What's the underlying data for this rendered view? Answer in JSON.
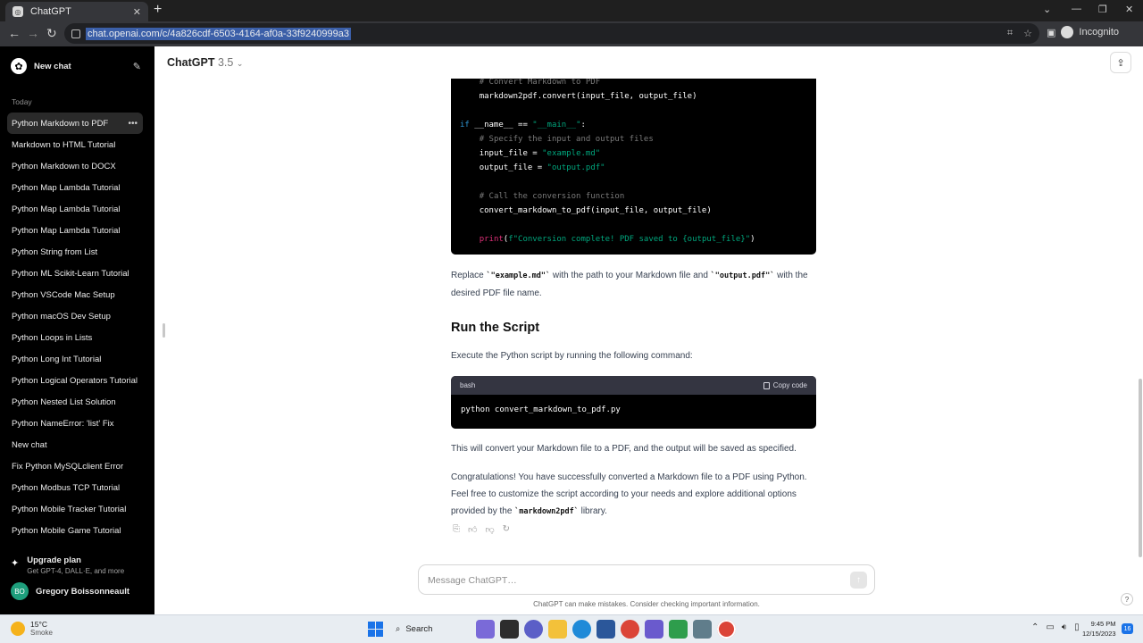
{
  "browser": {
    "tab_title": "ChatGPT",
    "tab_close": "✕",
    "new_tab": "+",
    "url": "chat.openai.com/c/4a826cdf-6503-4164-af0a-33f9240999a3",
    "profile_label": "Incognito"
  },
  "sidebar": {
    "new_chat_label": "New chat",
    "section_label": "Today",
    "items": [
      {
        "label": "Python Markdown to PDF"
      },
      {
        "label": "Markdown to HTML Tutorial"
      },
      {
        "label": "Python Markdown to DOCX"
      },
      {
        "label": "Python Map Lambda Tutorial"
      },
      {
        "label": "Python Map Lambda Tutorial"
      },
      {
        "label": "Python Map Lambda Tutorial"
      },
      {
        "label": "Python String from List"
      },
      {
        "label": "Python ML Scikit-Learn Tutorial"
      },
      {
        "label": "Python VSCode Mac Setup"
      },
      {
        "label": "Python macOS Dev Setup"
      },
      {
        "label": "Python Loops in Lists"
      },
      {
        "label": "Python Long Int Tutorial"
      },
      {
        "label": "Python Logical Operators Tutorial"
      },
      {
        "label": "Python Nested List Solution"
      },
      {
        "label": "Python NameError: 'list' Fix"
      },
      {
        "label": "New chat"
      },
      {
        "label": "Fix Python MySQLclient Error"
      },
      {
        "label": "Python Modbus TCP Tutorial"
      },
      {
        "label": "Python Mobile Tracker Tutorial"
      },
      {
        "label": "Python Mobile Game Tutorial"
      }
    ],
    "upgrade_title": "Upgrade plan",
    "upgrade_sub": "Get GPT-4, DALL·E, and more",
    "user_initials": "BO",
    "user_name": "Gregory Boissonneault"
  },
  "header": {
    "model_name": "ChatGPT",
    "model_version": "3.5"
  },
  "code_block_1": {
    "lines": [
      {
        "indent": "    ",
        "parts": [
          {
            "t": "cm",
            "v": "# Convert Markdown to PDF"
          }
        ]
      },
      {
        "indent": "    ",
        "parts": [
          {
            "t": "tx",
            "v": "markdown2pdf.convert(input_file, output_file)"
          }
        ]
      },
      {
        "indent": "",
        "parts": []
      },
      {
        "indent": "",
        "parts": [
          {
            "t": "kw",
            "v": "if"
          },
          {
            "t": "tx",
            "v": " __name__ == "
          },
          {
            "t": "st",
            "v": "\"__main__\""
          },
          {
            "t": "tx",
            "v": ":"
          }
        ]
      },
      {
        "indent": "    ",
        "parts": [
          {
            "t": "cm",
            "v": "# Specify the input and output files"
          }
        ]
      },
      {
        "indent": "    ",
        "parts": [
          {
            "t": "tx",
            "v": "input_file = "
          },
          {
            "t": "st",
            "v": "\"example.md\""
          }
        ]
      },
      {
        "indent": "    ",
        "parts": [
          {
            "t": "tx",
            "v": "output_file = "
          },
          {
            "t": "st",
            "v": "\"output.pdf\""
          }
        ]
      },
      {
        "indent": "",
        "parts": []
      },
      {
        "indent": "    ",
        "parts": [
          {
            "t": "cm",
            "v": "# Call the conversion function"
          }
        ]
      },
      {
        "indent": "    ",
        "parts": [
          {
            "t": "tx",
            "v": "convert_markdown_to_pdf(input_file, output_file)"
          }
        ]
      },
      {
        "indent": "",
        "parts": []
      },
      {
        "indent": "    ",
        "parts": [
          {
            "t": "fn",
            "v": "print"
          },
          {
            "t": "tx",
            "v": "("
          },
          {
            "t": "st",
            "v": "f\"Conversion complete! PDF saved to {output_file}\""
          },
          {
            "t": "tx",
            "v": ")"
          }
        ]
      }
    ]
  },
  "content": {
    "replace_a": "Replace ",
    "replace_code1": "`\"example.md\"`",
    "replace_b": " with the path to your Markdown file and ",
    "replace_code2": "`\"output.pdf\"`",
    "replace_c": " with the desired PDF file name.",
    "heading": "Run the Script",
    "execute_text": "Execute the Python script by running the following command:",
    "code2_lang": "bash",
    "code2_copy": "Copy code",
    "code2_cmd": "python convert_markdown_to_pdf.py",
    "convert_text": "This will convert your Markdown file to a PDF, and the output will be saved as specified.",
    "congrats_a": "Congratulations! You have successfully converted a Markdown file to a PDF using Python. Feel free to customize the script according to your needs and explore additional options provided by the ",
    "congrats_code": "`markdown2pdf`",
    "congrats_b": " library."
  },
  "composer": {
    "placeholder": "Message ChatGPT…",
    "disclaimer": "ChatGPT can make mistakes. Consider checking important information.",
    "help": "?"
  },
  "taskbar": {
    "temp": "15°C",
    "weather": "Smoke",
    "search_label": "Search",
    "time": "9:45 PM",
    "date": "12/15/2023",
    "notif_count": "16"
  }
}
